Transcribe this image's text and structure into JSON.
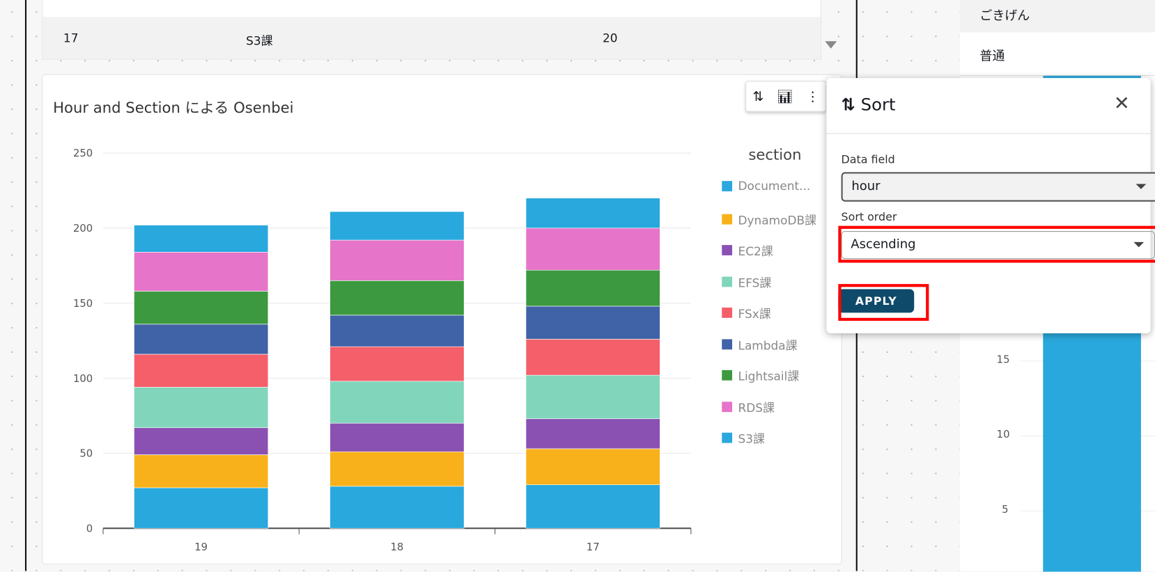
{
  "table": {
    "row": {
      "hour": "17",
      "section": "S3課",
      "value": "20"
    }
  },
  "chart_title": "Hour and Section による Osenbei",
  "toolbar": {
    "sort_icon": "sort-icon",
    "chart_icon": "bar-chart-icon",
    "more_icon": "more-vertical-icon"
  },
  "chart_data": {
    "type": "bar",
    "stacked": true,
    "title": "Hour and Section による Osenbei",
    "categories": [
      "19",
      "18",
      "17"
    ],
    "ylim": [
      0,
      250
    ],
    "yticks": [
      "0",
      "50",
      "100",
      "150",
      "200",
      "250"
    ],
    "grid": true,
    "legend_title": "section",
    "legend_placement": "right",
    "series": [
      {
        "name": "Document...",
        "color": "#29a8dd",
        "values": [
          27,
          28,
          29
        ]
      },
      {
        "name": "DynamoDB課",
        "color": "#f8b11a",
        "values": [
          22,
          23,
          24
        ]
      },
      {
        "name": "EC2課",
        "color": "#8a51b3",
        "values": [
          18,
          19,
          20
        ]
      },
      {
        "name": "EFS課",
        "color": "#81d5bb",
        "values": [
          27,
          28,
          29
        ]
      },
      {
        "name": "FSx課",
        "color": "#f45f6a",
        "values": [
          22,
          23,
          24
        ]
      },
      {
        "name": "Lambda課",
        "color": "#4062a6",
        "values": [
          20,
          21,
          22
        ]
      },
      {
        "name": "Lightsail課",
        "color": "#3c993f",
        "values": [
          22,
          23,
          24
        ]
      },
      {
        "name": "RDS課",
        "color": "#e674c8",
        "values": [
          26,
          27,
          28
        ]
      },
      {
        "name": "S3課",
        "color": "#29a8dd",
        "values": [
          18,
          19,
          20
        ]
      }
    ]
  },
  "right_panel": {
    "rows": [
      "ごきげん",
      "普通"
    ],
    "yticks": [
      "15",
      "10",
      "5"
    ],
    "bar_color": "#29a8dd"
  },
  "sort_popup": {
    "title": "Sort",
    "data_field_label": "Data field",
    "data_field_value": "hour",
    "sort_order_label": "Sort order",
    "sort_order_value": "Ascending",
    "apply_label": "APPLY"
  }
}
